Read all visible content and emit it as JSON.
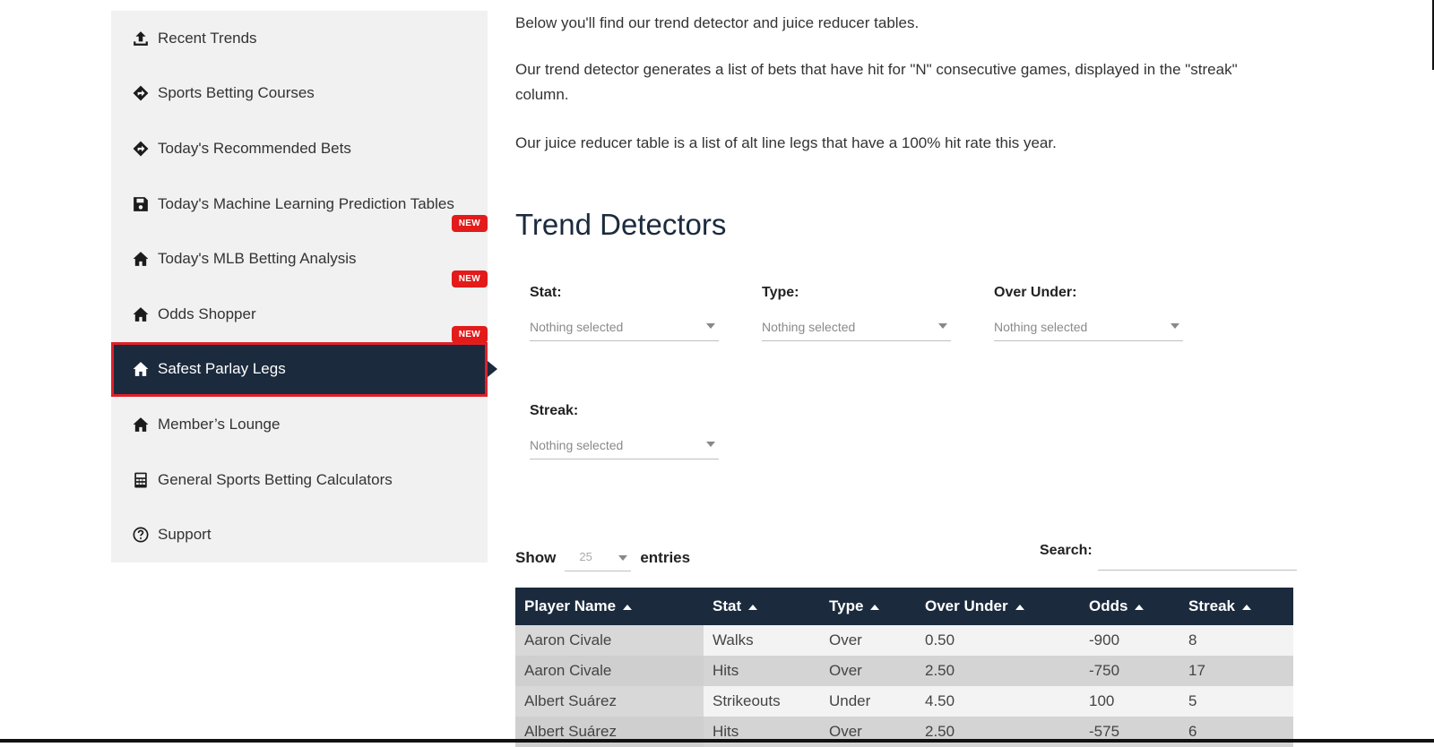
{
  "sidebar": {
    "items": [
      {
        "label": "Recent Trends",
        "icon": "upload-icon",
        "badge": ""
      },
      {
        "label": "Sports Betting Courses",
        "icon": "diamond-arrow-icon",
        "badge": ""
      },
      {
        "label": "Today's Recommended Bets",
        "icon": "diamond-arrow-icon",
        "badge": ""
      },
      {
        "label": "Today's Machine Learning Prediction Tables",
        "icon": "save-icon",
        "badge": ""
      },
      {
        "label": "Today's MLB Betting Analysis",
        "icon": "home-icon",
        "badge": "NEW"
      },
      {
        "label": "Odds Shopper",
        "icon": "home-icon",
        "badge": "NEW"
      },
      {
        "label": "Safest Parlay Legs",
        "icon": "home-icon",
        "badge": "NEW",
        "active": true
      },
      {
        "label": "Member’s Lounge",
        "icon": "home-icon",
        "badge": ""
      },
      {
        "label": "General Sports Betting Calculators",
        "icon": "calculator-icon",
        "badge": ""
      },
      {
        "label": "Support",
        "icon": "question-circle-icon",
        "badge": ""
      }
    ]
  },
  "intro": {
    "p1": "Below you'll find our trend detector and juice reducer tables.",
    "p2": "Our trend detector generates a list of bets that have hit for \"N\" consecutive games, displayed in the \"streak\" column.",
    "p3": "Our juice reducer table is a list of alt line legs that have a 100% hit rate this year."
  },
  "section_title": "Trend Detectors",
  "filters": {
    "stat": {
      "label": "Stat:",
      "value": "Nothing selected"
    },
    "type": {
      "label": "Type:",
      "value": "Nothing selected"
    },
    "over_under": {
      "label": "Over Under:",
      "value": "Nothing selected"
    },
    "streak": {
      "label": "Streak:",
      "value": "Nothing selected"
    }
  },
  "table_controls": {
    "show_label": "Show",
    "entries_label": "entries",
    "length_value": "25",
    "search_label": "Search:",
    "search_value": ""
  },
  "table": {
    "headers": [
      "Player Name",
      "Stat",
      "Type",
      "Over Under",
      "Odds",
      "Streak"
    ],
    "rows": [
      [
        "Aaron Civale",
        "Walks",
        "Over",
        "0.50",
        "-900",
        "8"
      ],
      [
        "Aaron Civale",
        "Hits",
        "Over",
        "2.50",
        "-750",
        "17"
      ],
      [
        "Albert Suárez",
        "Strikeouts",
        "Under",
        "4.50",
        "100",
        "5"
      ],
      [
        "Albert Suárez",
        "Hits",
        "Over",
        "2.50",
        "-575",
        "6"
      ]
    ]
  },
  "colors": {
    "navy": "#1b2a3d",
    "badge_red": "#e31b1b",
    "active_outline": "#e0202a",
    "sidebar_bg": "#f1f1f1"
  }
}
